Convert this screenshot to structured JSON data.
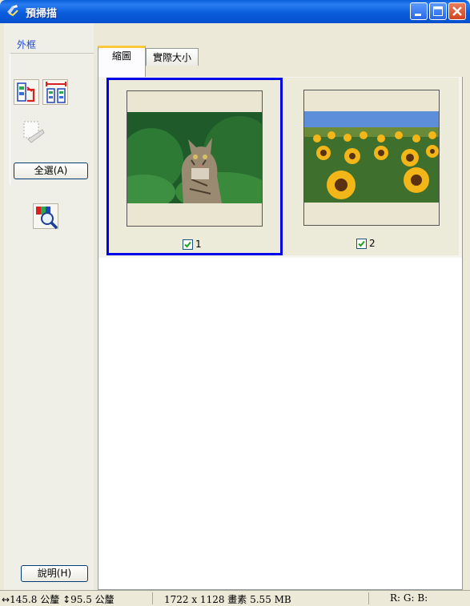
{
  "window": {
    "title": "預掃描",
    "buttons": [
      "minimize",
      "maximize",
      "close"
    ]
  },
  "colors": {
    "titlebar": "#0a5ddc",
    "selection_border": "#0000e8",
    "group_label": "#1f48c8",
    "tab_highlight": "#ffc83c"
  },
  "left_panel": {
    "group_label": "外框",
    "tools": [
      {
        "icon": "auto-locate-frame-icon",
        "enabled": true
      },
      {
        "icon": "create-frame-icon",
        "enabled": true
      },
      {
        "icon": "delete-frame-icon",
        "enabled": false
      }
    ],
    "select_all_label": "全選(A)",
    "zoom_icon": "zoom-preview-icon",
    "help_label": "說明(H)"
  },
  "tabs": [
    {
      "label": "縮圖",
      "active": true
    },
    {
      "label": "實際大小",
      "active": false
    }
  ],
  "thumbnails": [
    {
      "label": "1",
      "checked": true,
      "selected": true,
      "subject": "cat"
    },
    {
      "label": "2",
      "checked": true,
      "selected": false,
      "subject": "sunflowers"
    }
  ],
  "status": {
    "width_text": "145.8 公釐",
    "height_text": "95.5 公釐",
    "size_text": "1722 x 1128 畫素 5.55 MB",
    "color_text": "R: G: B:"
  }
}
